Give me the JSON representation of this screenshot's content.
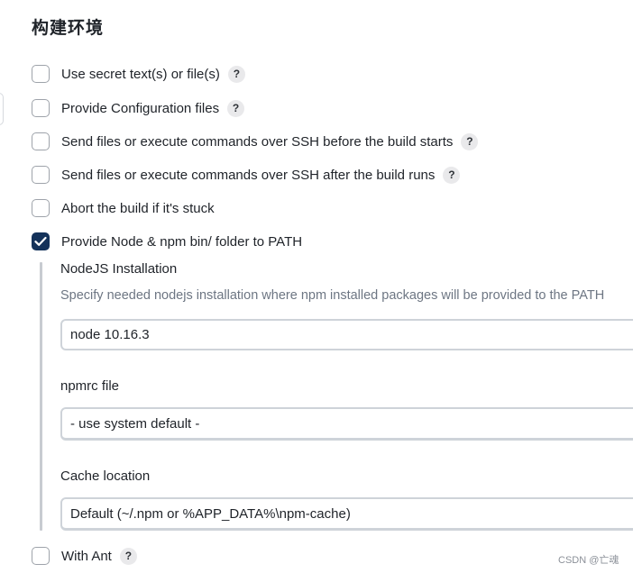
{
  "section": {
    "title": "构建环境"
  },
  "options": [
    {
      "label": "Use secret text(s) or file(s)",
      "checked": false,
      "help": "?"
    },
    {
      "label": "Provide Configuration files",
      "checked": false,
      "help": "?"
    },
    {
      "label": "Send files or execute commands over SSH before the build starts",
      "checked": false,
      "help": "?"
    },
    {
      "label": "Send files or execute commands over SSH after the build runs",
      "checked": false,
      "help": "?"
    },
    {
      "label": "Abort the build if it's stuck",
      "checked": false
    },
    {
      "label": "Provide Node & npm bin/ folder to PATH",
      "checked": true
    }
  ],
  "node_config": {
    "installation_label": "NodeJS Installation",
    "installation_description": "Specify needed nodejs installation where npm installed packages will be provided to the PATH",
    "installation_value": "node 10.16.3",
    "npmrc_label": "npmrc file",
    "npmrc_value": "- use system default -",
    "cache_label": "Cache location",
    "cache_value": "Default (~/.npm or %APP_DATA%\\npm-cache)"
  },
  "with_ant": {
    "label": "With Ant",
    "checked": false,
    "help": "?"
  },
  "watermark": "CSDN @亡魂",
  "colors": {
    "checked_fill": "#14325a",
    "description_text": "#6d7683",
    "help_badge": "#e9e9eb"
  }
}
